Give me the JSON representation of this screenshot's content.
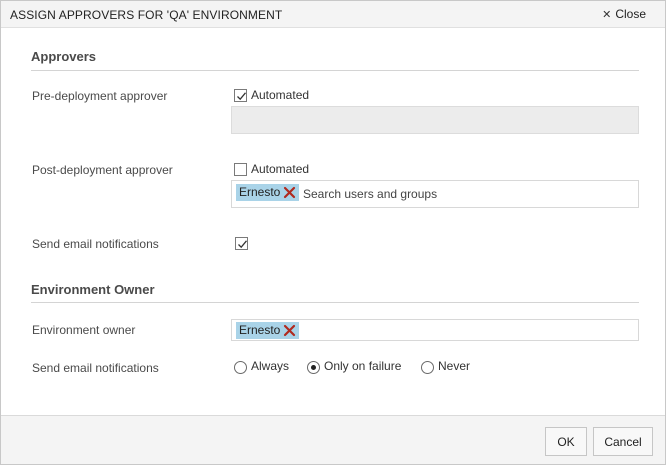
{
  "dialog": {
    "title": "ASSIGN APPROVERS FOR 'QA' ENVIRONMENT",
    "close_label": "Close"
  },
  "approvers": {
    "heading": "Approvers",
    "pre_deployment": {
      "label": "Pre-deployment approver",
      "automated_label": "Automated",
      "automated_checked": true
    },
    "post_deployment": {
      "label": "Post-deployment approver",
      "automated_label": "Automated",
      "automated_checked": false,
      "tags": [
        "Ernesto"
      ],
      "search_placeholder": "Search users and groups"
    },
    "send_email": {
      "label": "Send email notifications",
      "checked": true
    }
  },
  "environment_owner": {
    "heading": "Environment Owner",
    "owner": {
      "label": "Environment owner",
      "tags": [
        "Ernesto"
      ]
    },
    "send_email": {
      "label": "Send email notifications",
      "options": [
        "Always",
        "Only on failure",
        "Never"
      ],
      "selected": "Only on failure"
    }
  },
  "footer": {
    "ok_label": "OK",
    "cancel_label": "Cancel"
  },
  "colors": {
    "tag_background": "#a9d3e8",
    "remove_icon": "#b02a1f",
    "title_bar": "#f4f4f4"
  }
}
